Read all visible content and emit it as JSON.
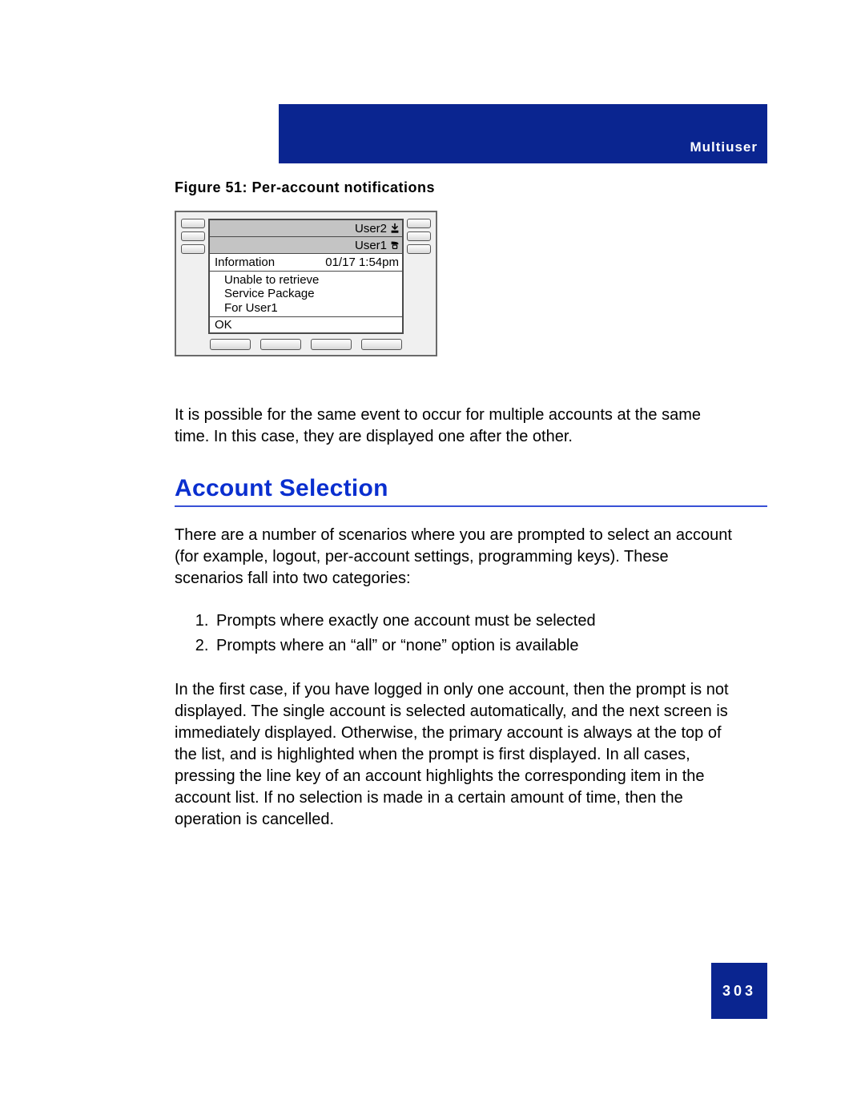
{
  "header": {
    "section": "Multiuser"
  },
  "figure": {
    "caption": "Figure 51: Per-account notifications",
    "lcd": {
      "user2": "User2",
      "user1": "User1",
      "info_label": "Information",
      "timestamp": "01/17 1:54pm",
      "msg_l1": "Unable to retrieve",
      "msg_l2": "Service Package",
      "msg_l3": "For User1",
      "ok": "OK"
    }
  },
  "para1": "It is possible for the same event to occur for multiple accounts at the same time. In this case, they are displayed one after the other.",
  "section_title": "Account Selection",
  "para2": "There are a number of scenarios where you are prompted to select an account (for example, logout, per-account settings, programming keys). These scenarios fall into two categories:",
  "list": {
    "item1": "Prompts where exactly one account must be selected",
    "item2": "Prompts where an “all” or “none” option is available"
  },
  "para3": "In the first case, if you have logged in only one account, then the prompt is not displayed. The single account is selected automatically, and the next screen is immediately displayed. Otherwise, the primary account is always at the top of the list, and is highlighted when the prompt is first displayed. In all cases, pressing the line key of an account highlights the corresponding item in the account list. If no selection is made in a certain amount of time, then the operation is cancelled.",
  "page_number": "303"
}
